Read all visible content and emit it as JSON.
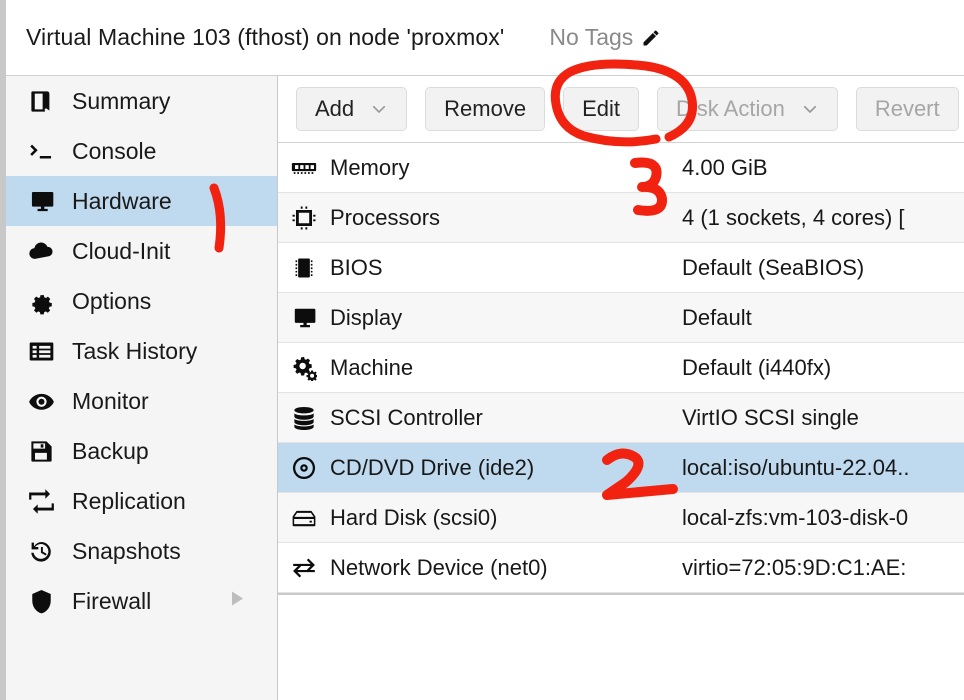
{
  "header": {
    "title": "Virtual Machine 103 (fthost) on node 'proxmox'",
    "tags_label": "No Tags",
    "tag_edit_icon": "pencil-icon"
  },
  "sidebar": {
    "items": [
      {
        "label": "Summary",
        "icon": "book-icon",
        "selected": false,
        "has_submenu": false
      },
      {
        "label": "Console",
        "icon": "terminal-icon",
        "selected": false,
        "has_submenu": false
      },
      {
        "label": "Hardware",
        "icon": "monitor-icon",
        "selected": true,
        "has_submenu": false
      },
      {
        "label": "Cloud-Init",
        "icon": "cloud-icon",
        "selected": false,
        "has_submenu": false
      },
      {
        "label": "Options",
        "icon": "gear-icon",
        "selected": false,
        "has_submenu": false
      },
      {
        "label": "Task History",
        "icon": "list-icon",
        "selected": false,
        "has_submenu": false
      },
      {
        "label": "Monitor",
        "icon": "eye-icon",
        "selected": false,
        "has_submenu": false
      },
      {
        "label": "Backup",
        "icon": "floppy-disk-icon",
        "selected": false,
        "has_submenu": false
      },
      {
        "label": "Replication",
        "icon": "sync-icon",
        "selected": false,
        "has_submenu": false
      },
      {
        "label": "Snapshots",
        "icon": "history-icon",
        "selected": false,
        "has_submenu": false
      },
      {
        "label": "Firewall",
        "icon": "shield-icon",
        "selected": false,
        "has_submenu": true
      }
    ]
  },
  "toolbar": {
    "buttons": [
      {
        "label": "Add",
        "caret": true,
        "disabled": false
      },
      {
        "label": "Remove",
        "caret": false,
        "disabled": false
      },
      {
        "label": "Edit",
        "caret": false,
        "disabled": false
      },
      {
        "label": "Disk Action",
        "caret": true,
        "disabled": true
      },
      {
        "label": "Revert",
        "caret": false,
        "disabled": true
      }
    ]
  },
  "hardware_table": {
    "rows": [
      {
        "icon": "memory-icon",
        "name": "Memory",
        "value": "4.00 GiB",
        "selected": false
      },
      {
        "icon": "cpu-icon",
        "name": "Processors",
        "value": "4 (1 sockets, 4 cores) [",
        "selected": false
      },
      {
        "icon": "chip-icon",
        "name": "BIOS",
        "value": "Default (SeaBIOS)",
        "selected": false
      },
      {
        "icon": "monitor-icon",
        "name": "Display",
        "value": "Default",
        "selected": false
      },
      {
        "icon": "cogs-icon",
        "name": "Machine",
        "value": "Default (i440fx)",
        "selected": false
      },
      {
        "icon": "database-icon",
        "name": "SCSI Controller",
        "value": "VirtIO SCSI single",
        "selected": false
      },
      {
        "icon": "optical-disc-icon",
        "name": "CD/DVD Drive (ide2)",
        "value": "local:iso/ubuntu-22.04..",
        "selected": true
      },
      {
        "icon": "hard-disk-icon",
        "name": "Hard Disk (scsi0)",
        "value": "local-zfs:vm-103-disk-0",
        "selected": false
      },
      {
        "icon": "network-arrows-icon",
        "name": "Network Device (net0)",
        "value": "virtio=72:05:9D:C1:AE:",
        "selected": false
      }
    ]
  },
  "annotations": {
    "color": "#f22211",
    "marks": [
      {
        "label": "1",
        "kind": "stroke-mark",
        "target": "sidebar-item-hardware"
      },
      {
        "label": "2",
        "kind": "digit-mark",
        "target": "hw-row-cddvd-drive"
      },
      {
        "label": "3",
        "kind": "digit-mark",
        "target": "toolbar-edit-button"
      },
      {
        "label": "",
        "kind": "circle-mark",
        "target": "toolbar-edit-button"
      }
    ]
  },
  "colors": {
    "selection_blue": "#bfdaee",
    "sidebar_bg": "#f5f5f5",
    "row_alt_bg": "#f7f7f7",
    "annotation_red": "#f22211",
    "disabled_text": "#a6a6a6"
  }
}
